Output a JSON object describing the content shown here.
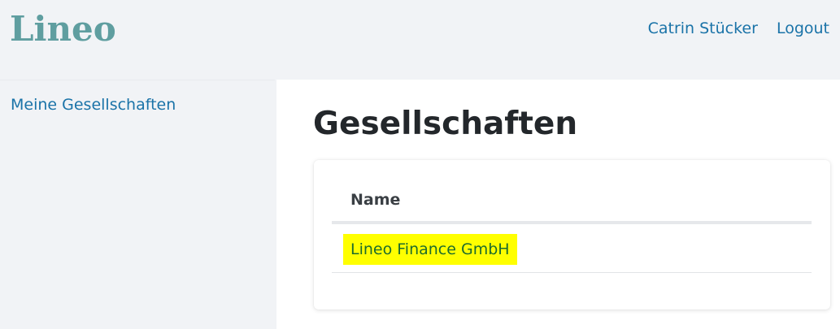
{
  "app": {
    "logo_text": "Lineo"
  },
  "header": {
    "user_name": "Catrin Stücker",
    "logout_label": "Logout"
  },
  "sidebar": {
    "items": [
      {
        "label": "Meine Gesellschaften"
      }
    ]
  },
  "main": {
    "title": "Gesellschaften",
    "table": {
      "columns": [
        "Name"
      ],
      "rows": [
        {
          "name": "Lineo Finance GmbH"
        }
      ]
    }
  },
  "colors": {
    "brand": "#5f9ea0",
    "link": "#1a73a8",
    "highlight": "#ffff00",
    "highlight_text": "#1c6b2d"
  }
}
